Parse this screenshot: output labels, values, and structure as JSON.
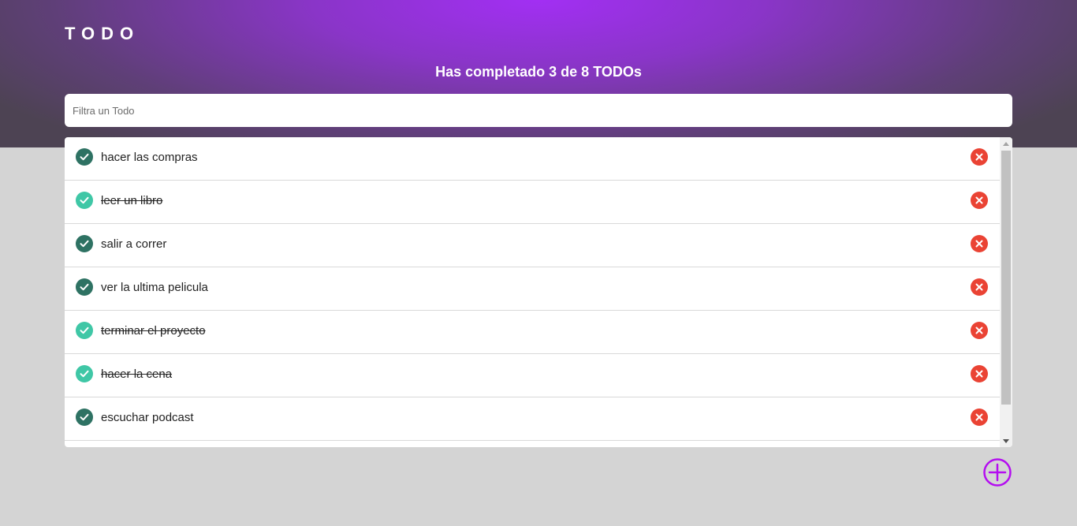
{
  "app": {
    "title": "TODO"
  },
  "counter": {
    "text": "Has completado 3 de 8 TODOs"
  },
  "search": {
    "placeholder": "Filtra un Todo",
    "value": ""
  },
  "todos": [
    {
      "text": "hacer las compras",
      "completed": false
    },
    {
      "text": "leer un libro",
      "completed": true
    },
    {
      "text": "salir a correr",
      "completed": false
    },
    {
      "text": "ver la ultima pelicula",
      "completed": false
    },
    {
      "text": "terminar el proyecto",
      "completed": true
    },
    {
      "text": "hacer la cena",
      "completed": true
    },
    {
      "text": "escuchar podcast",
      "completed": false
    }
  ],
  "icons": {
    "check": "check-circle-icon",
    "delete": "close-circle-icon",
    "add": "plus-circle-icon"
  },
  "colors": {
    "accent": "#a22ff3",
    "check_pending": "#2e7263",
    "check_done": "#3fc7a6",
    "delete": "#ea4334",
    "page_bg": "#d4d4d4"
  }
}
